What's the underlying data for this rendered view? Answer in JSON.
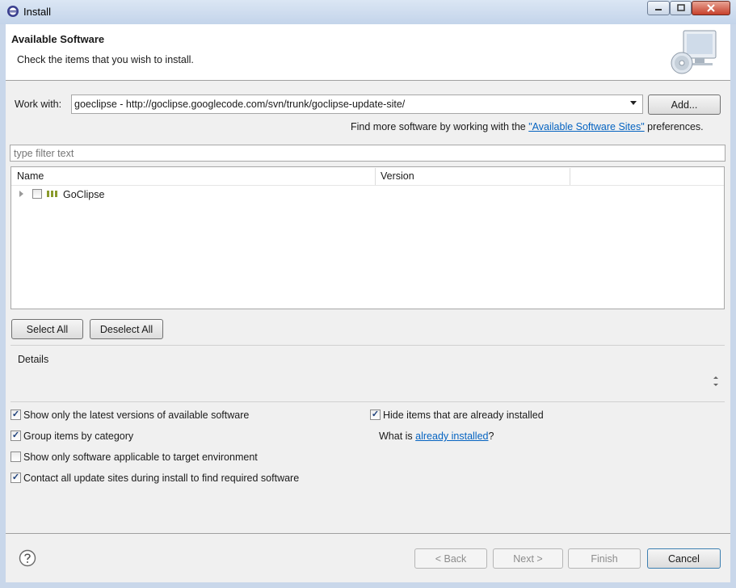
{
  "window": {
    "title": "Install",
    "icon": "eclipse-icon"
  },
  "header": {
    "title": "Available Software",
    "description": "Check the items that you wish to install.",
    "image_icon": "cd-monitor-icon"
  },
  "work_with": {
    "label": "Work with:",
    "value": "goeclipse - http://goclipse.googlecode.com/svn/trunk/goclipse-update-site/",
    "add_label": "Add..."
  },
  "find_more": {
    "prefix": "Find more software by working with the ",
    "link": "\"Available Software Sites\"",
    "suffix": " preferences."
  },
  "filter": {
    "placeholder": "type filter text"
  },
  "table": {
    "columns": [
      "Name",
      "Version"
    ],
    "rows": [
      {
        "name": "GoClipse",
        "version": "",
        "checked": false,
        "icon": "category-icon"
      }
    ]
  },
  "buttons": {
    "select_all": "Select All",
    "deselect_all": "Deselect All"
  },
  "details": {
    "label": "Details"
  },
  "options": [
    {
      "label": "Show only the latest versions of available software",
      "checked": true
    },
    {
      "label": "Group items by category",
      "checked": true
    },
    {
      "label": "Show only software applicable to target environment",
      "checked": false
    },
    {
      "label": "Contact all update sites during install to find required software",
      "checked": true
    }
  ],
  "hide_installed": {
    "label": "Hide items that are already installed",
    "checked": true
  },
  "what_is": {
    "prefix": "What is ",
    "link": "already installed",
    "suffix": "?"
  },
  "footer": {
    "back": "< Back",
    "next": "Next >",
    "finish": "Finish",
    "cancel": "Cancel",
    "help_icon": "help-icon"
  },
  "colors": {
    "link": "#0563c1",
    "title_bar": "#c3d4ea",
    "close_button": "#c7402b"
  }
}
